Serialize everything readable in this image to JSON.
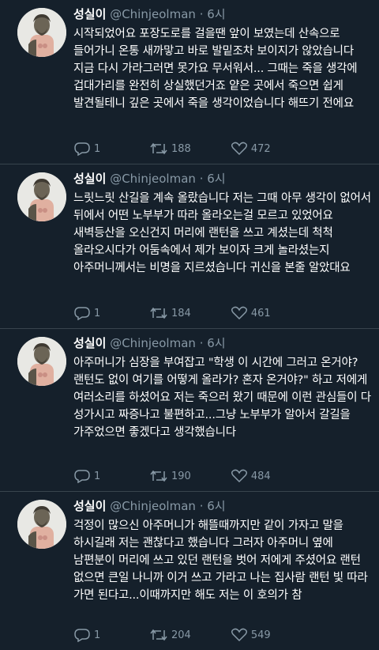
{
  "tweets": [
    {
      "name": "성실이",
      "handle": "@Chinjeolman",
      "dot": "·",
      "time": "6시",
      "text": "시작되었어요 포장도로를 걸을땐 앞이 보였는데 산속으로 들어가니 온통 새까맣고 바로 발밑조차 보이지가 않았습니다 지금 다시 가라그러면 못가요 무서워서... 그때는 죽을 생각에 겁대가리를 완전히 상실했던거죠 얕은 곳에서 죽으면 쉽게 발견될테니 깊은 곳에서 죽을 생각이었습니다 해뜨기 전에요",
      "replies": "1",
      "retweets": "188",
      "likes": "472"
    },
    {
      "name": "성실이",
      "handle": "@Chinjeolman",
      "dot": "·",
      "time": "6시",
      "text": "느릿느릿 산길을 계속 올랐습니다 저는 그때 아무 생각이 없어서 뒤에서 어떤 노부부가 따라 올라오는걸 모르고 있었어요 새벽등산을 오신건지 머리에 랜턴을 쓰고 계셨는데 척척 올라오시다가 어둠속에서 제가 보이자 크게 놀라셨는지 아주머니께서는 비명을 지르셨습니다 귀신을 본줄 알았대요",
      "replies": "1",
      "retweets": "184",
      "likes": "461"
    },
    {
      "name": "성실이",
      "handle": "@Chinjeolman",
      "dot": "·",
      "time": "6시",
      "text": "아주머니가 심장을 부여잡고 \"학생 이 시간에 그러고 온거야? 랜턴도 없이 여기를 어떻게 올라가? 혼자 온거야?\" 하고 저에게 여러소리를 하셨어요 저는 죽으러 왔기 때문에 이런 관심들이 다 성가시고 짜증나고 불편하고...그냥 노부부가 알아서 갈길을 가주었으면 좋겠다고 생각했습니다",
      "replies": "1",
      "retweets": "190",
      "likes": "484"
    },
    {
      "name": "성실이",
      "handle": "@Chinjeolman",
      "dot": "·",
      "time": "6시",
      "text": "걱정이 많으신 아주머니가 해뜰때까지만 같이 가자고 말을 하시길래 저는 괜찮다고 했습니다 그러자 아주머니 옆에 남편분이 머리에 쓰고 있던 랜턴을 벗어 저에게 주셨어요 랜턴 없으면 큰일 나니까 이거 쓰고 가라고 나는 집사람 랜턴 빛 따라 가면 된다고...이때까지만 해도 저는 이 호의가 참",
      "replies": "1",
      "retweets": "204",
      "likes": "549"
    }
  ],
  "icons": {
    "avatar": "statue-avatar-icon",
    "reply": "reply-icon",
    "retweet": "retweet-icon",
    "like": "heart-icon"
  },
  "colors": {
    "background": "#15202b",
    "secondary_text": "#8899a6",
    "divider": "#38444d"
  }
}
